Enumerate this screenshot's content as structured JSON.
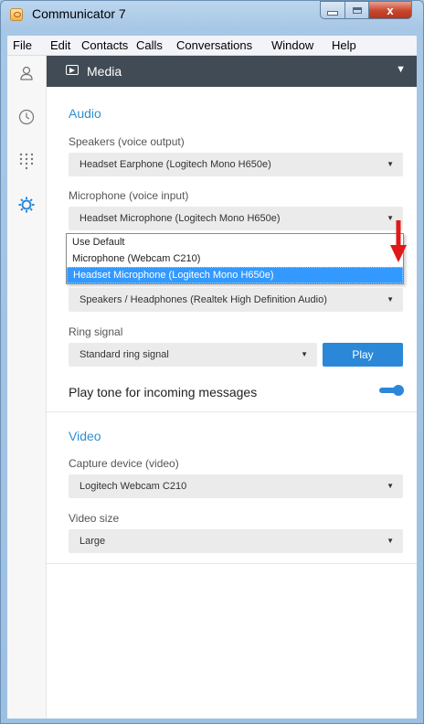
{
  "window": {
    "title": "Communicator 7",
    "close_glyph": "x"
  },
  "menu": [
    "File",
    "Edit",
    "Contacts",
    "Calls",
    "Conversations",
    "Window",
    "Help"
  ],
  "sidebar": {
    "items": [
      {
        "icon": "contacts-icon",
        "active": false
      },
      {
        "icon": "history-icon",
        "active": false
      },
      {
        "icon": "dialpad-icon",
        "active": false
      },
      {
        "icon": "settings-gear-icon",
        "active": true
      }
    ]
  },
  "topbar": {
    "title": "Media",
    "caret": "▼"
  },
  "audio": {
    "title": "Audio",
    "speakers_label": "Speakers (voice output)",
    "speakers_value": "Headset Earphone (Logitech Mono H650e)",
    "microphone_label": "Microphone (voice input)",
    "microphone_value": "Headset Microphone (Logitech Mono H650e)",
    "microphone_options": [
      "Use Default",
      "Microphone (Webcam C210)",
      "Headset Microphone (Logitech Mono H650e)"
    ],
    "ringer_value": "Speakers / Headphones (Realtek High Definition Audio)",
    "ring_signal_label": "Ring signal",
    "ring_signal_value": "Standard ring signal",
    "play_label": "Play",
    "play_tone_label": "Play tone for incoming messages",
    "play_tone_enabled": true
  },
  "video": {
    "title": "Video",
    "capture_label": "Capture device (video)",
    "capture_value": "Logitech Webcam C210",
    "size_label": "Video size",
    "size_value": "Large"
  },
  "colors": {
    "accent": "#2b88d8",
    "section_title": "#2f8fd1",
    "topbar_bg": "#414b55",
    "arrow": "#e01818"
  }
}
